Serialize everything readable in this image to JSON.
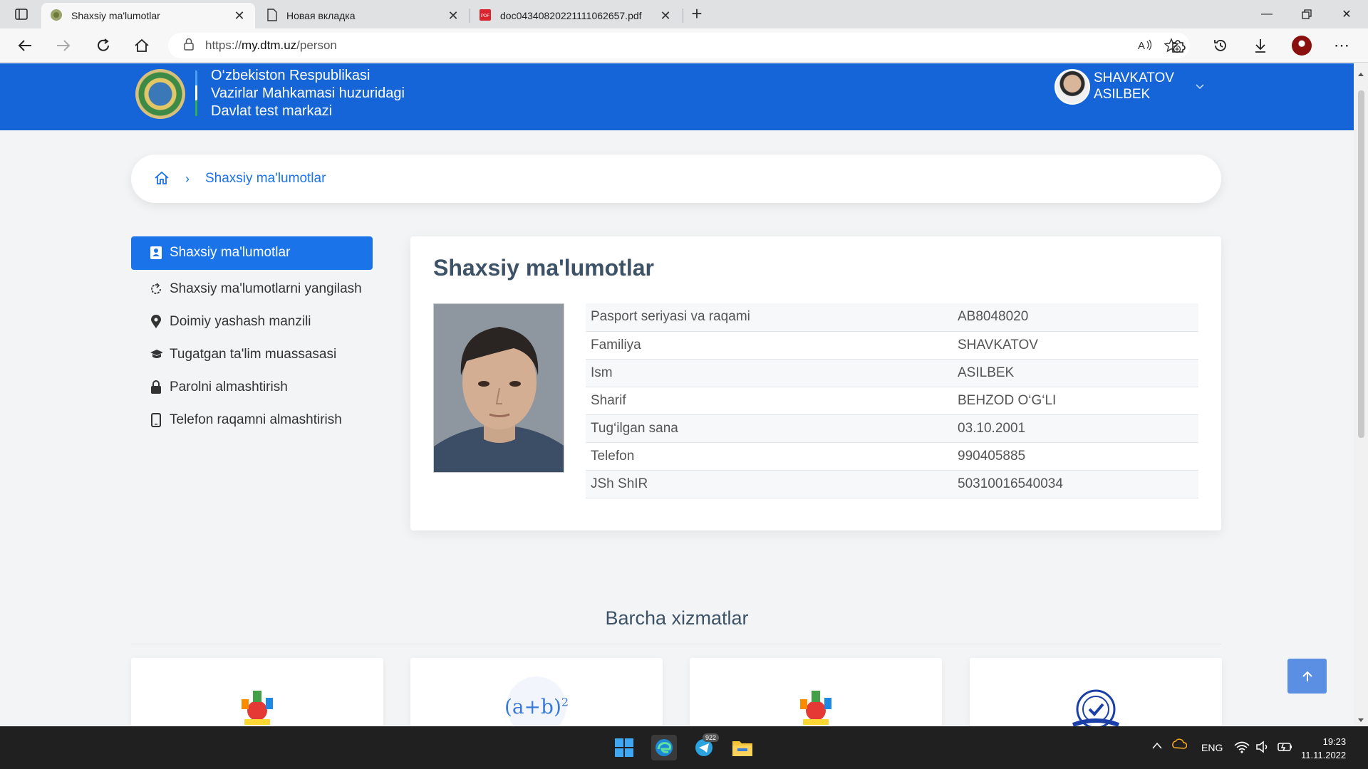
{
  "browser": {
    "tabs": [
      {
        "title": "Shaxsiy ma'lumotlar",
        "active": true,
        "icon": "emblem-favicon"
      },
      {
        "title": "Новая вкладка",
        "active": false,
        "icon": "page-icon"
      },
      {
        "title": "doc04340820221111062657.pdf",
        "active": false,
        "icon": "pdf-icon"
      }
    ],
    "url_scheme": "https://",
    "url_host": "my.dtm.uz",
    "url_path": "/person"
  },
  "header": {
    "org_line1": "O‘zbekiston Respublikasi",
    "org_line2": "Vazirlar Mahkamasi huzuridagi",
    "org_line3": "Davlat test markazi",
    "user_last": "SHAVKATOV",
    "user_first": "ASILBEK",
    "brand_color": "#1565d8"
  },
  "breadcrumb": {
    "current": "Shaxsiy ma'lumotlar"
  },
  "sidebar": {
    "items": [
      {
        "label": "Shaxsiy ma'lumotlar",
        "icon": "user-card-icon",
        "active": true
      },
      {
        "label": "Shaxsiy ma'lumotlarni yangilash",
        "icon": "refresh-icon",
        "active": false
      },
      {
        "label": "Doimiy yashash manzili",
        "icon": "map-pin-icon",
        "active": false
      },
      {
        "label": "Tugatgan ta'lim muassasasi",
        "icon": "graduation-cap-icon",
        "active": false
      },
      {
        "label": "Parolni almashtirish",
        "icon": "lock-icon",
        "active": false
      },
      {
        "label": "Telefon raqamni almashtirish",
        "icon": "phone-icon",
        "active": false
      }
    ]
  },
  "profile": {
    "title": "Shaxsiy ma'lumotlar",
    "rows": [
      {
        "key": "Pasport seriyasi va raqami",
        "value": "AB8048020"
      },
      {
        "key": "Familiya",
        "value": "SHAVKATOV"
      },
      {
        "key": "Ism",
        "value": "ASILBEK"
      },
      {
        "key": "Sharif",
        "value": "BEHZOD O‘G‘LI"
      },
      {
        "key": "Tug‘ilgan sana",
        "value": "03.10.2001"
      },
      {
        "key": "Telefon",
        "value": "990405885"
      },
      {
        "key": "JSh ShIR",
        "value": "50310016540034"
      }
    ]
  },
  "services": {
    "title": "Barcha xizmatlar",
    "formula_base": "(a+b)",
    "formula_exp": "2"
  },
  "taskbar": {
    "telegram_badge": "922",
    "lang": "ENG",
    "time": "19:23",
    "date": "11.11.2022"
  }
}
